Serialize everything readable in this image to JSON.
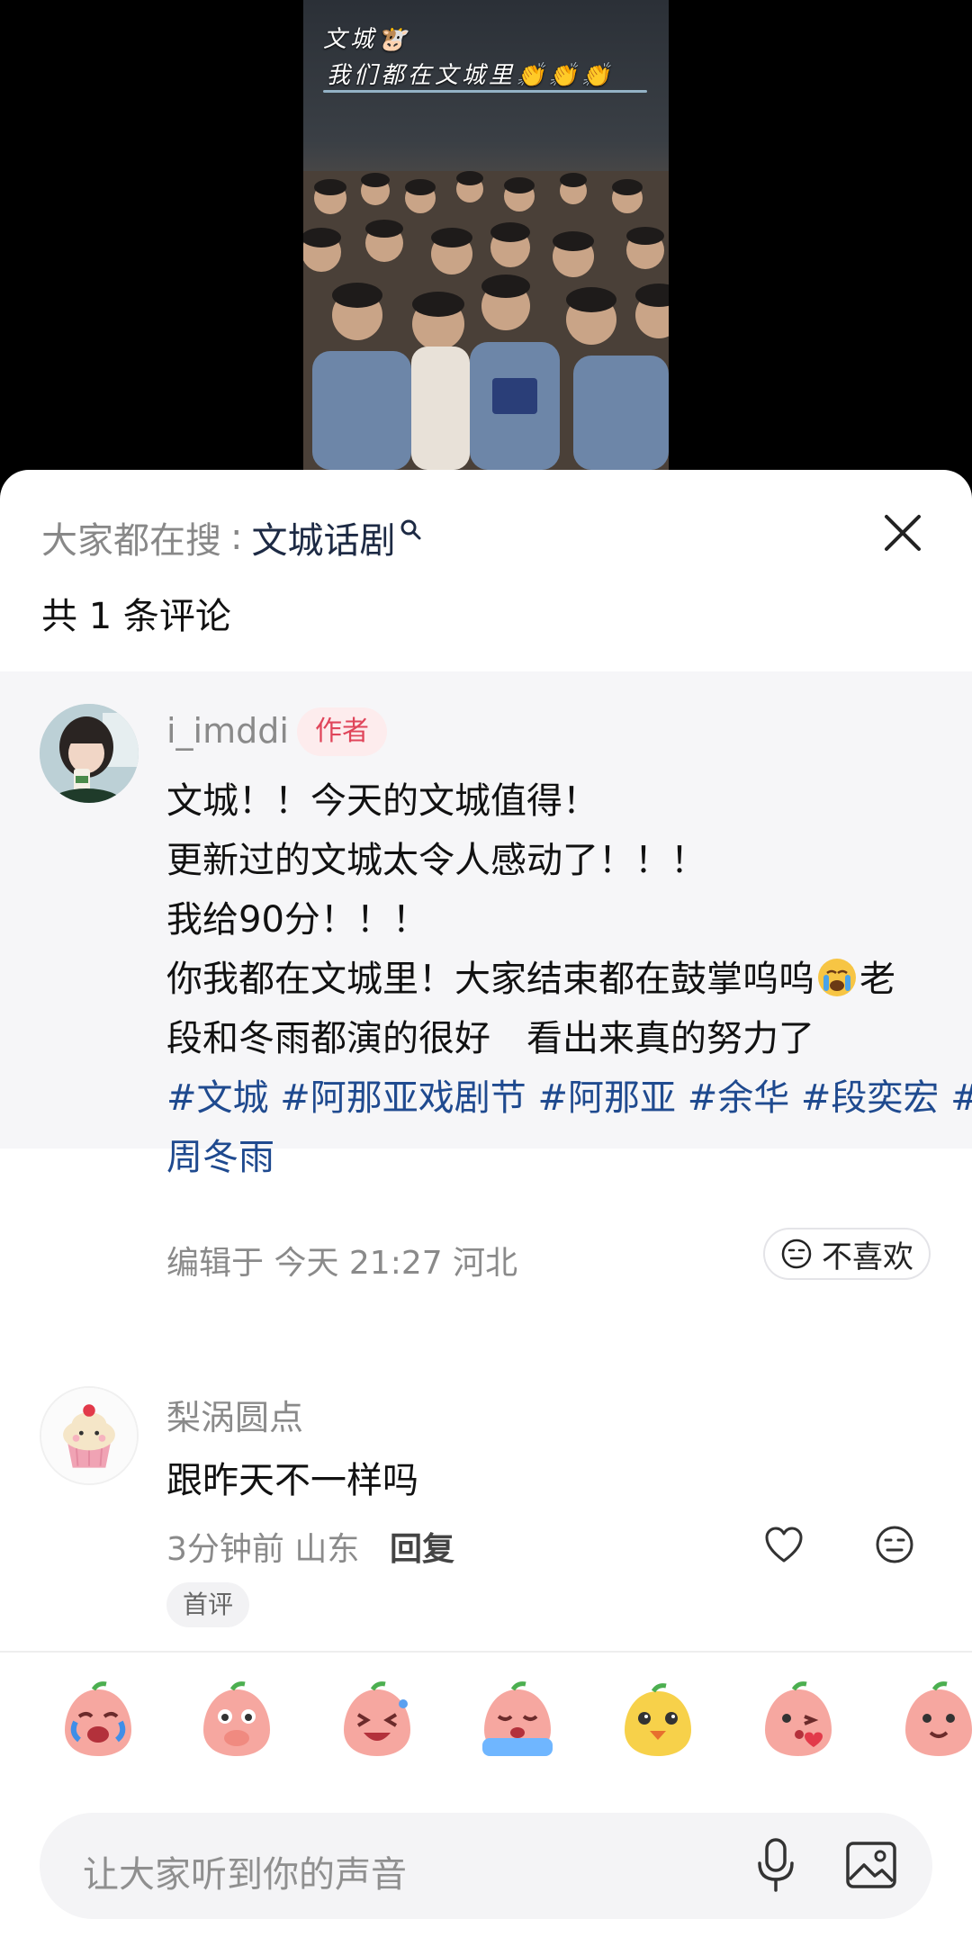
{
  "video": {
    "caption_line1": "文城🐮",
    "caption_line2": "我们都在文城里👏👏👏"
  },
  "sheet": {
    "search_label": "大家都在搜",
    "search_separator": ":",
    "search_term": "文城话剧",
    "comment_count": "共 1 条评论"
  },
  "comments": [
    {
      "username": "i_imddi",
      "badge": "作者",
      "lines": [
        "文城！！今天的文城值得！",
        "更新过的文城太令人感动了！！！",
        "我给90分！！！",
        "你我都在文城里！大家结束都在鼓掌呜呜",
        "老",
        "段和冬雨都演的很好　看出来真的努力了",
        "#文城 #阿那亚戏剧节 #阿那亚 #余华 #段奕宏 #",
        "周冬雨"
      ],
      "meta": "编辑于 今天 21:27 河北",
      "dislike_label": "不喜欢"
    },
    {
      "username": "梨涡圆点",
      "text": "跟昨天不一样吗",
      "meta": "3分钟前 山东",
      "reply_label": "回复",
      "badge": "首评"
    }
  ],
  "input": {
    "placeholder": "让大家听到你的声音"
  },
  "colors": {
    "accent_link": "#1f4a8f",
    "author_badge": "#e0455a",
    "sheet_bg": "#ffffff",
    "pinned_bg": "#f6f6f8"
  },
  "emoji_strip": [
    "crying-peach-emoji",
    "covering-mouth-peach-emoji",
    "laughing-peach-emoji",
    "sobbing-peach-emoji",
    "yellow-chick-emoji",
    "kissing-peach-emoji",
    "smiling-peach-emoji"
  ]
}
